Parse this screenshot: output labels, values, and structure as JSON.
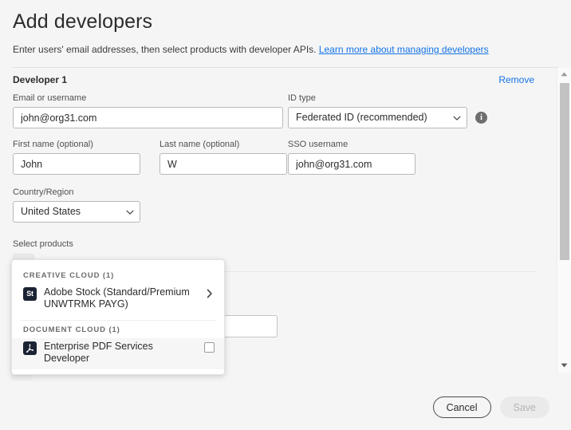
{
  "header": {
    "title": "Add developers",
    "subtitle_text": "Enter users' email addresses, then select products with developer APIs.",
    "link_text": "Learn more about managing developers"
  },
  "developer": {
    "section_title": "Developer 1",
    "remove_label": "Remove",
    "fields": {
      "email": {
        "label": "Email or username",
        "value": "john@org31.com",
        "placeholder": "Email or username"
      },
      "id_type": {
        "label": "ID type",
        "value": "Federated ID (recommended)",
        "options": [
          "Federated ID (recommended)"
        ]
      },
      "info_glyph": "i",
      "first_name": {
        "label": "First name (optional)",
        "value": "John",
        "placeholder": ""
      },
      "last_name": {
        "label": "Last name (optional)",
        "value": "W",
        "placeholder": ""
      },
      "sso_username": {
        "label": "SSO username",
        "value": "john@org31.com",
        "placeholder": ""
      },
      "country": {
        "label": "Country/Region",
        "value": "United States",
        "options": [
          "United States"
        ]
      }
    },
    "products": {
      "label": "Select products",
      "add_button_label": "+"
    },
    "hidden_add_button_label": "+"
  },
  "product_popup": {
    "groups": [
      {
        "heading": "CREATIVE CLOUD (1)",
        "items": [
          {
            "name": "Adobe Stock (Standard/Premium UNWTRMK PAYG)",
            "icon": "adobe-stock-icon",
            "icon_text": "St",
            "control": "chevron-right",
            "hovered": false
          }
        ]
      },
      {
        "heading": "DOCUMENT CLOUD (1)",
        "items": [
          {
            "name": "Enterprise PDF Services Developer",
            "icon": "adobe-acrobat-icon",
            "icon_text": "",
            "control": "checkbox",
            "checked": false,
            "hovered": true
          }
        ]
      }
    ]
  },
  "footer": {
    "cancel_label": "Cancel",
    "save_label": "Save"
  },
  "scrollbar": {
    "up_arrow": "caret-up",
    "down_arrow": "caret-down"
  },
  "colors": {
    "accent_link": "#1473e6",
    "background": "#f5f5f5",
    "text": "#2c2c2c",
    "icon_badge": "#1b2234",
    "scrollbar_thumb": "#c2c2c2"
  }
}
